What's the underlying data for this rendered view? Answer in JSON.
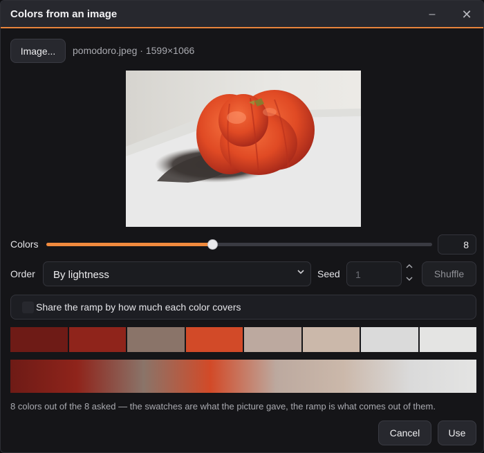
{
  "window": {
    "title": "Colors from an image",
    "minimize_glyph": "–",
    "close_glyph": "✕"
  },
  "toolbar": {
    "image_button": "Image...",
    "file_info": "pomodoro.jpeg · 1599×1066"
  },
  "controls": {
    "colors_label": "Colors",
    "colors_value": "8",
    "colors_min": 1,
    "colors_max": 16,
    "colors_fill_fraction": 0.43,
    "order_label": "Order",
    "order_selected": "By lightness",
    "seed_label": "Seed",
    "seed_placeholder": "1",
    "shuffle_button": "Shuffle",
    "share_ramp_label": "Share the ramp by how much each color covers",
    "share_ramp_checked": false
  },
  "palette": {
    "swatches": [
      "#6e1b16",
      "#8f241b",
      "#8a7469",
      "#d24a28",
      "#bca99f",
      "#cbb8aa",
      "#dadada",
      "#e4e4e3"
    ]
  },
  "status": {
    "footnote": "8 colors out of the 8 asked — the swatches are what the picture gave, the ramp is what comes out of them."
  },
  "actions": {
    "cancel_button": "Cancel",
    "use_button": "Use"
  },
  "colors": {
    "accent": "#f08a3e",
    "window_bg": "#151518",
    "titlebar_bg": "#27282e"
  }
}
